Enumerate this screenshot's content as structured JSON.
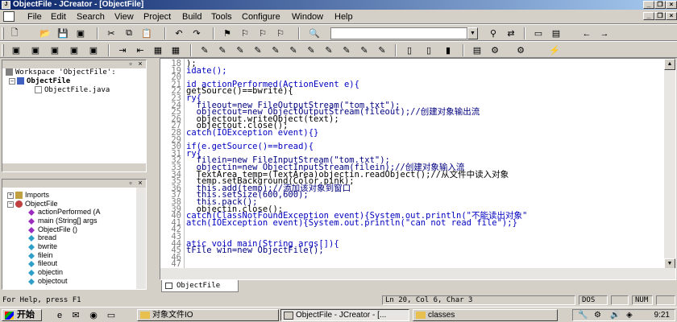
{
  "window": {
    "title": "ObjectFile - JCreator - [ObjectFile]",
    "min": "_",
    "restore": "❐",
    "close": "×"
  },
  "menu": [
    "File",
    "Edit",
    "Search",
    "View",
    "Project",
    "Build",
    "Tools",
    "Configure",
    "Window",
    "Help"
  ],
  "workspace": {
    "root": "Workspace 'ObjectFile':",
    "project": "ObjectFile",
    "file": "ObjectFile.java"
  },
  "classview": {
    "imports": "Imports",
    "cls": "ObjectFile",
    "members": [
      "actionPerformed (A",
      "main (String[] args",
      "ObjectFile ()",
      "bread",
      "bwrite",
      "filein",
      "fileout",
      "objectin",
      "objectout"
    ]
  },
  "code": {
    "lines": [
      {
        "n": "18",
        "t": ");"
      },
      {
        "n": "19",
        "t": "idate();"
      },
      {
        "n": "20",
        "t": ""
      },
      {
        "n": "21",
        "t": "id actionPerformed(ActionEvent e){"
      },
      {
        "n": "22",
        "t": "getSource()==bwrite){"
      },
      {
        "n": "23",
        "t": "ry{"
      },
      {
        "n": "24",
        "t": "  fileout=new FileOutputStream(\"tom.txt\");"
      },
      {
        "n": "25",
        "t": "  objectout=new ObjectOutputStream(fileout);//创建对象输出流"
      },
      {
        "n": "26",
        "t": "  objectout.writeObject(text);"
      },
      {
        "n": "27",
        "t": "  objectout.close();"
      },
      {
        "n": "28",
        "t": "catch(IOException event){}"
      },
      {
        "n": "29",
        "t": ""
      },
      {
        "n": "30",
        "t": "if(e.getSource()==bread){"
      },
      {
        "n": "31",
        "t": "ry{"
      },
      {
        "n": "32",
        "t": "  filein=new FileInputStream(\"tom.txt\");"
      },
      {
        "n": "33",
        "t": "  objectin=new ObjectInputStream(filein);//创建对象输入流"
      },
      {
        "n": "34",
        "t": "  TextArea temp=(TextArea)objectin.readObject();//从文件中读入对象"
      },
      {
        "n": "35",
        "t": "  temp.setBackground(Color.pink);"
      },
      {
        "n": "36",
        "t": "  this.add(temp);//添加该对象到窗口"
      },
      {
        "n": "37",
        "t": "  this.setSize(600,600);"
      },
      {
        "n": "38",
        "t": "  this.pack();"
      },
      {
        "n": "39",
        "t": "  objectin.close();"
      },
      {
        "n": "40",
        "t": "catch(ClassNotFoundException event){System.out.println(\"不能读出对象\""
      },
      {
        "n": "41",
        "t": "atch(IOException event){System.out.println(\"can not read file\");}"
      },
      {
        "n": "42",
        "t": ""
      },
      {
        "n": "43",
        "t": ""
      },
      {
        "n": "44",
        "t": "atic void main(String args[]){"
      },
      {
        "n": "45",
        "t": "tFile win=new ObjectFile();"
      },
      {
        "n": "46",
        "t": ""
      },
      {
        "n": "47",
        "t": ""
      }
    ]
  },
  "editor_tab": "ObjectFile",
  "status": {
    "help": "For Help, press F1",
    "pos": "Ln 20, Col 6, Char 3",
    "dos": "DOS",
    "num": "NUM"
  },
  "taskbar": {
    "start": "开始",
    "tasks": [
      "对象文件IO",
      "ObjectFile - JCreator - [...",
      "classes"
    ],
    "clock": "9:21"
  }
}
